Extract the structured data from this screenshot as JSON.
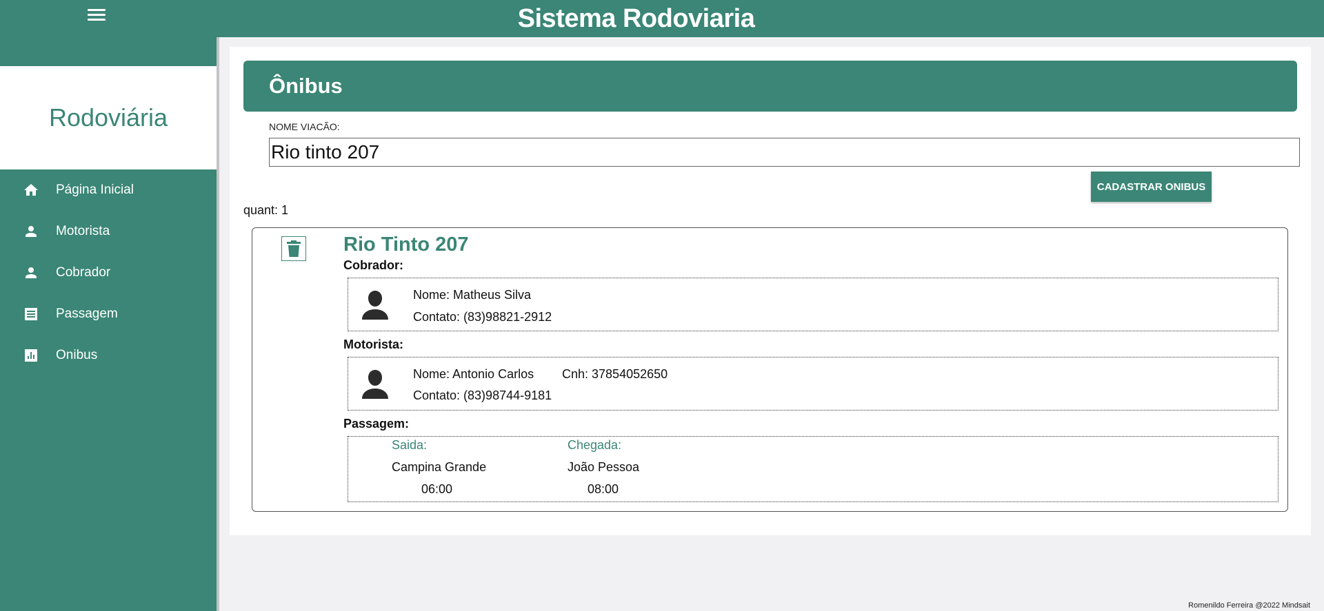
{
  "header": {
    "title": "Sistema Rodoviaria",
    "menu_icon": "hamburger-menu-icon"
  },
  "sidebar": {
    "brand": "Rodoviária",
    "items": [
      {
        "label": "Página Inicial",
        "icon": "home-icon"
      },
      {
        "label": "Motorista",
        "icon": "person-icon"
      },
      {
        "label": "Cobrador",
        "icon": "person-icon"
      },
      {
        "label": "Passagem",
        "icon": "receipt-icon"
      },
      {
        "label": "Onibus",
        "icon": "bar-chart-icon"
      }
    ]
  },
  "main": {
    "title": "Ônibus",
    "form": {
      "label": "NOME VIACÃO:",
      "value": "Rio tinto 207",
      "button": "CADASTRAR ONIBUS"
    },
    "count": "quant: 1",
    "bus": {
      "name": "Rio Tinto 207",
      "cobrador": {
        "section": "Cobrador:",
        "nome": "Nome: Matheus Silva",
        "contato": "Contato: (83)98821-2912"
      },
      "motorista": {
        "section": "Motorista:",
        "nome": "Nome: Antonio Carlos",
        "cnh": "Cnh: 37854052650",
        "contato": "Contato: (83)98744-9181"
      },
      "passagem": {
        "section": "Passagem:",
        "saida_label": "Saida:",
        "saida_city": "Campina Grande",
        "saida_time": "06:00",
        "chegada_label": "Chegada:",
        "chegada_city": "João Pessoa",
        "chegada_time": "08:00"
      }
    }
  },
  "footer": {
    "text": "Romenildo Ferreira @2022 Mindsait"
  },
  "colors": {
    "primary": "#3b8676",
    "background": "#f1f1f3"
  }
}
